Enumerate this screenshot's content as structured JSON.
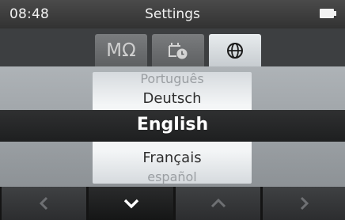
{
  "status_bar": {
    "time": "08:48",
    "title": "Settings"
  },
  "tabs": [
    {
      "label": "MΩ",
      "icon": "megohm",
      "active": false
    },
    {
      "label": "",
      "icon": "timer-icon",
      "active": false
    },
    {
      "label": "",
      "icon": "globe-icon",
      "active": true
    }
  ],
  "language_picker": {
    "above_2": "Português",
    "above_1": "Deutsch",
    "selected": "English",
    "below_1": "Français",
    "below_2": "español"
  },
  "nav": {
    "left_icon": "chevron-left-icon",
    "down_icon": "chevron-down-icon",
    "up_icon": "chevron-up-icon",
    "right_icon": "chevron-right-icon",
    "active": "down"
  }
}
